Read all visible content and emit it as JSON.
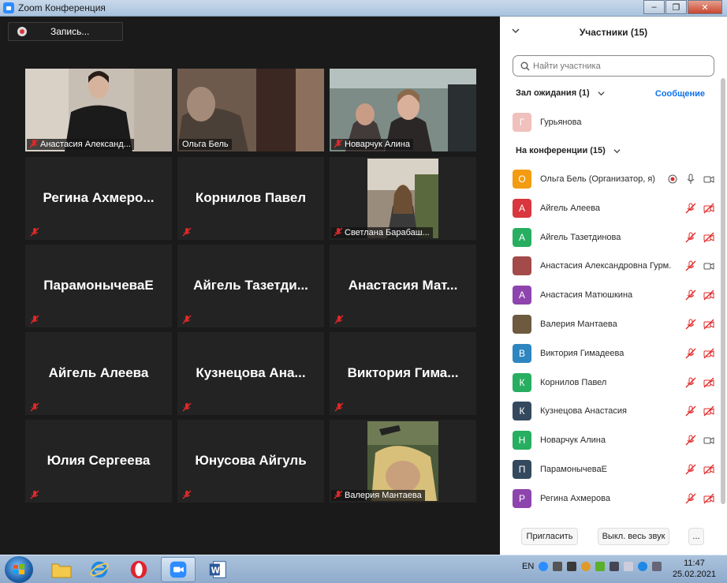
{
  "window": {
    "title": "Zoom Конференция",
    "controls": [
      "–",
      "❐",
      "✕"
    ]
  },
  "toolbar": {
    "record_label": "Запись..."
  },
  "colors": {
    "accent": "#0e72ed",
    "active_speaker": "#d6e45a",
    "muted": "#e02828"
  },
  "tiles": [
    {
      "name": "Анастасия Александровна Гурм...",
      "kind": "video",
      "label": "Анастасия Александ..."
    },
    {
      "name": "Ольга Бель",
      "kind": "video",
      "label": "Ольга Бель",
      "active": true
    },
    {
      "name": "Новарчук Алина",
      "kind": "video",
      "label": "Новарчук Алина"
    },
    {
      "name": "Регина Ахмерова",
      "kind": "name",
      "label": "Регина Ахмеро..."
    },
    {
      "name": "Корнилов Павел",
      "kind": "name",
      "label": "Корнилов Павел"
    },
    {
      "name": "Светлана Барабашова",
      "kind": "photo",
      "label": "Светлана Барабаш..."
    },
    {
      "name": "ПарамонычеваЕ",
      "kind": "name",
      "label": "ПарамонычеваЕ"
    },
    {
      "name": "Айгель Тазетдинова",
      "kind": "name",
      "label": "Айгель Тазетди..."
    },
    {
      "name": "Анастасия Матюшкина",
      "kind": "name",
      "label": "Анастасия Мат..."
    },
    {
      "name": "Айгель Алеева",
      "kind": "name",
      "label": "Айгель Алеева"
    },
    {
      "name": "Кузнецова Анастасия",
      "kind": "name",
      "label": "Кузнецова Ана..."
    },
    {
      "name": "Виктория Гимадеева",
      "kind": "name",
      "label": "Виктория Гима..."
    },
    {
      "name": "Юлия Сергеева",
      "kind": "name",
      "label": "Юлия Сергеева"
    },
    {
      "name": "Юнусова Айгуль",
      "kind": "name",
      "label": "Юнусова Айгуль"
    },
    {
      "name": "Валерия Мантаева",
      "kind": "photo",
      "label": "Валерия Мантаева"
    }
  ],
  "panel": {
    "title": "Участники (15)",
    "search_placeholder": "Найти участника",
    "waiting_title": "Зал ожидания (1)",
    "message_link": "Сообщение",
    "waiting": [
      {
        "initial": "Г",
        "name": "Гурьянова",
        "color": "#f0c0bc"
      }
    ],
    "meeting_title": "На конференции (15)",
    "participants": [
      {
        "initial": "О",
        "name": "Ольга Бель (Организатор, я)",
        "color": "#f39c12",
        "icons": "host"
      },
      {
        "initial": "А",
        "name": "Айгель Алеева",
        "color": "#d9363e",
        "icons": "muted"
      },
      {
        "initial": "А",
        "name": "Айгель Тазетдинова",
        "color": "#27ae60",
        "icons": "muted"
      },
      {
        "initial": "",
        "name": "Анастасия Александровна Гурм...",
        "color": "#a34a4a",
        "icons": "muted-video"
      },
      {
        "initial": "А",
        "name": "Анастасия Матюшкина",
        "color": "#8e44ad",
        "icons": "muted"
      },
      {
        "initial": "",
        "name": "Валерия Мантаева",
        "color": "#6d5a3f",
        "icons": "muted"
      },
      {
        "initial": "В",
        "name": "Виктория Гимадеева",
        "color": "#2e86c1",
        "icons": "muted"
      },
      {
        "initial": "К",
        "name": "Корнилов Павел",
        "color": "#27ae60",
        "icons": "muted"
      },
      {
        "initial": "К",
        "name": "Кузнецова Анастасия",
        "color": "#34495e",
        "icons": "muted"
      },
      {
        "initial": "Н",
        "name": "Новарчук Алина",
        "color": "#27ae60",
        "icons": "muted-video"
      },
      {
        "initial": "П",
        "name": "ПарамонычеваЕ",
        "color": "#34495e",
        "icons": "muted"
      },
      {
        "initial": "Р",
        "name": "Регина Ахмерова",
        "color": "#8e44ad",
        "icons": "muted"
      }
    ],
    "invite_label": "Пригласить",
    "mute_all_label": "Выкл. весь звук",
    "more_label": "..."
  },
  "taskbar": {
    "lang": "EN",
    "time": "11:47",
    "date": "25.02.2021",
    "apps": [
      "start-orb",
      "file-explorer",
      "internet-explorer",
      "opera",
      "zoom",
      "word"
    ]
  }
}
